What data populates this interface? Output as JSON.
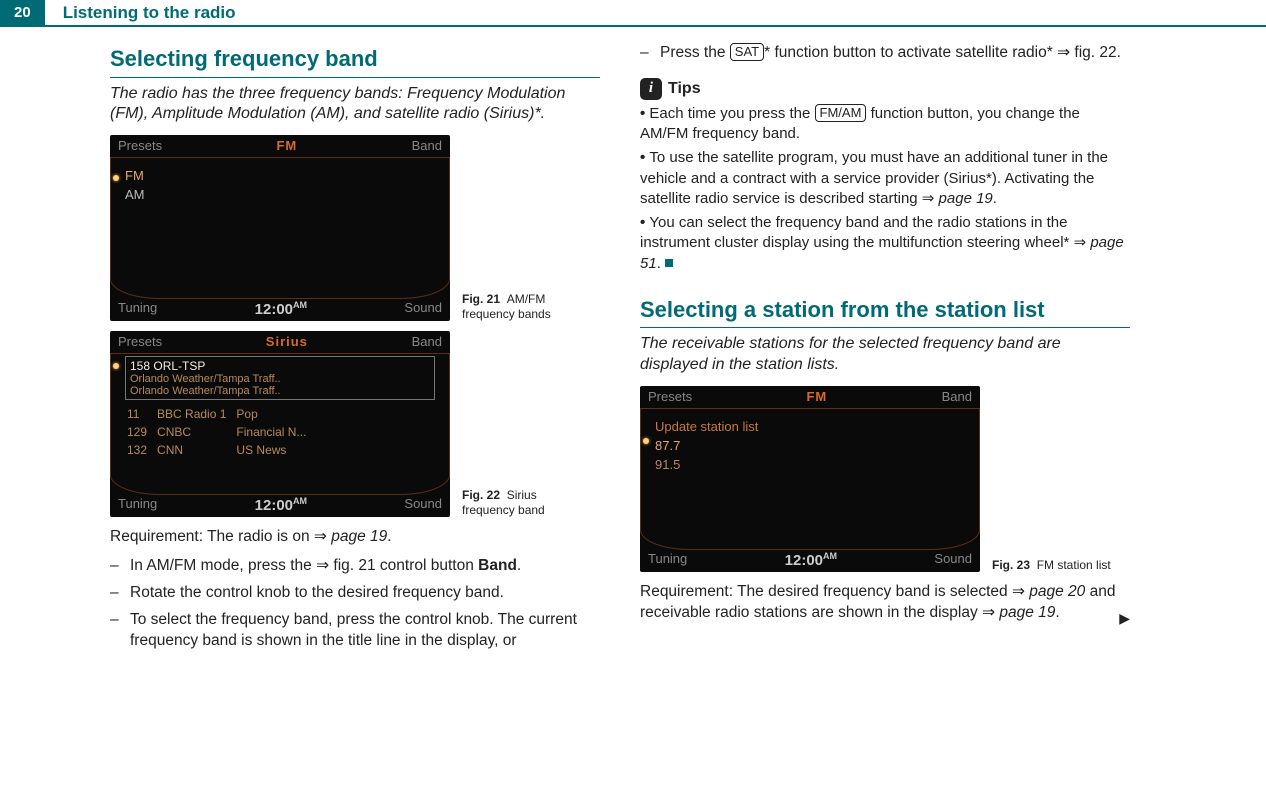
{
  "header": {
    "page_number": "20",
    "topic": "Listening to the radio"
  },
  "left": {
    "h2": "Selecting frequency band",
    "sub": "The radio has the three frequency bands: Frequency Modulation (FM), Amplitude Modulation (AM), and satellite radio (Sirius)*.",
    "fig21": {
      "top_left": "Presets",
      "top_center": "FM",
      "top_right": "Band",
      "items": [
        "FM",
        "AM"
      ],
      "bot_left": "Tuning",
      "clock": "12:00",
      "clock_suffix": "AM",
      "bot_right": "Sound",
      "caption_pre": "Fig. 21",
      "caption": "AM/FM frequency bands"
    },
    "fig22": {
      "top_left": "Presets",
      "top_center": "Sirius",
      "top_right": "Band",
      "box_title": "158 ORL-TSP",
      "box_l1": "Orlando Weather/Tampa Traff..",
      "box_l2": "Orlando Weather/Tampa Traff..",
      "rows": [
        {
          "a": "11",
          "b": "BBC Radio 1",
          "c": "Pop"
        },
        {
          "a": "129",
          "b": "CNBC",
          "c": "Financial N..."
        },
        {
          "a": "132",
          "b": "CNN",
          "c": "US News"
        }
      ],
      "bot_left": "Tuning",
      "clock": "12:00",
      "clock_suffix": "AM",
      "bot_right": "Sound",
      "caption_pre": "Fig. 22",
      "caption": "Sirius frequency band"
    },
    "req_pre": "Requirement: The radio is on ",
    "req_link": "page 19",
    "req_post": ".",
    "steps": {
      "s1a": "In AM/FM mode, press the ",
      "s1b": " fig. 21 control button ",
      "s1c": "Band",
      "s1d": ".",
      "s2": "Rotate the control knob to the desired frequency band.",
      "s3": "To select the frequency band, press the control knob. The current frequency band is shown in the title line in the display, or"
    }
  },
  "right": {
    "step4a": "Press the ",
    "step4_btn": "SAT",
    "step4b": "* function button to activate satellite radio* ",
    "step4c": " fig. 22.",
    "tips_label": "Tips",
    "tips": {
      "t1a": "Each time you press the ",
      "t1_btn": "FM/AM",
      "t1b": " function button, you change the AM/FM frequency band.",
      "t2a": "To use the satellite program, you must have an additional tuner in the vehicle and a contract with a service provider (Sirius*). Activating the satellite radio service is described starting ",
      "t2_link": "page 19",
      "t2b": ".",
      "t3a": "You can select the frequency band and the radio stations in the instrument cluster display using the multifunction steering wheel* ",
      "t3_link": "page 51",
      "t3b": "."
    },
    "h2": "Selecting a station from the station list",
    "sub": "The receivable stations for the selected frequency band are displayed in the station lists.",
    "fig23": {
      "top_left": "Presets",
      "top_center": "FM",
      "top_right": "Band",
      "update": "Update station list",
      "items": [
        "87.7",
        "91.5"
      ],
      "bot_left": "Tuning",
      "clock": "12:00",
      "clock_suffix": "AM",
      "bot_right": "Sound",
      "caption_pre": "Fig. 23",
      "caption": "FM station list"
    },
    "req2a": "Requirement: The desired frequency band is selected ",
    "req2_link1": "page 20",
    "req2b": " and receivable radio stations are shown in the display ",
    "req2_link2": "page 19",
    "req2c": "."
  }
}
